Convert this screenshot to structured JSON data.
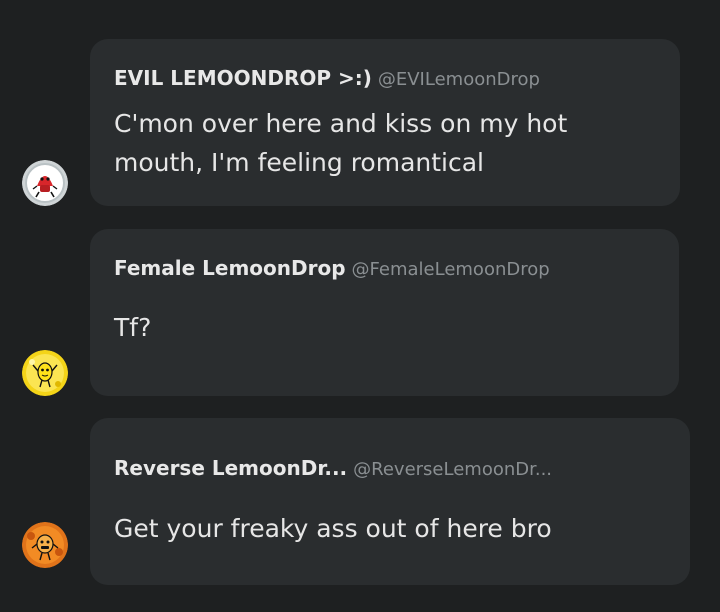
{
  "messages": [
    {
      "name": "EVIL LEMOONDROP >:)",
      "handle": "@EVILemoonDrop",
      "text": "C'mon over here and kiss on my hot mouth, I'm feeling romantical",
      "avatar_icon": "evil-lemoondrop-avatar"
    },
    {
      "name": "Female LemoonDrop",
      "handle": "@FemaleLemoonDrop",
      "text": "Tf?",
      "avatar_icon": "female-lemoondrop-avatar"
    },
    {
      "name": "Reverse LemoonDr...",
      "handle": "@ReverseLemoonDr...",
      "text": "Get your freaky ass out of here bro",
      "avatar_icon": "reverse-lemoondrop-avatar"
    }
  ],
  "colors": {
    "background": "#1e2021",
    "bubble": "#2a2d2f",
    "name": "#e8e8e8",
    "handle": "#8a8f92",
    "text": "#e6e6e6"
  }
}
